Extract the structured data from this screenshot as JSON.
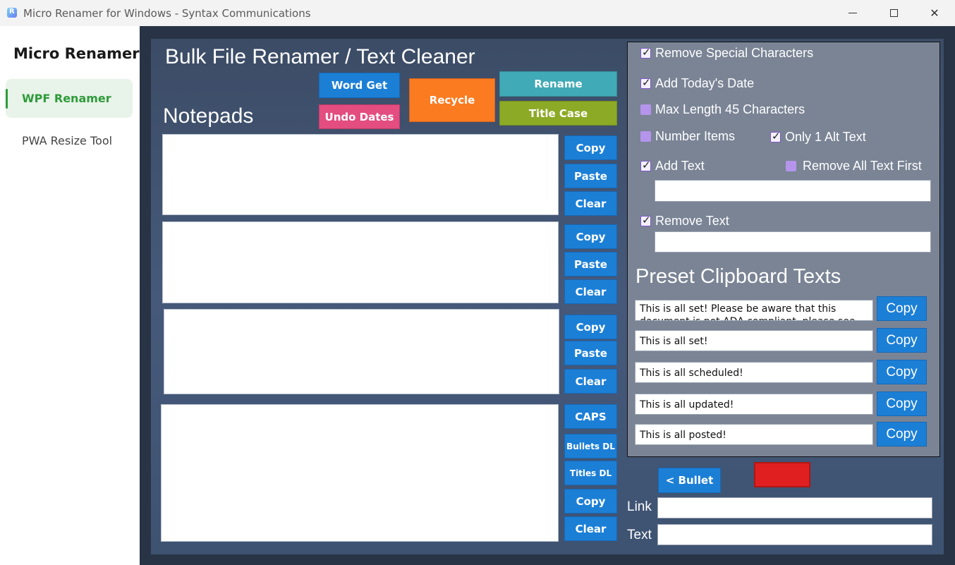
{
  "window": {
    "title": "Micro Renamer for Windows - Syntax Communications",
    "minimize_glyph": "",
    "close_glyph": "✕"
  },
  "sidebar": {
    "title": "Micro Renamer",
    "items": [
      {
        "label": "WPF Renamer",
        "active": true
      },
      {
        "label": "PWA Resize Tool",
        "active": false
      }
    ]
  },
  "main": {
    "title": "Bulk File Renamer / Text Cleaner",
    "notepads_heading": "Notepads",
    "top_buttons": {
      "word_get": "Word Get",
      "undo_dates": "Undo Dates",
      "recycle": "Recycle",
      "rename": "Rename",
      "title_case": "Title Case"
    },
    "notepad_buttons": {
      "pad1": [
        "Copy",
        "Paste",
        "Clear"
      ],
      "pad2": [
        "Copy",
        "Paste",
        "Clear"
      ],
      "pad3": [
        "Copy",
        "Paste",
        "Clear"
      ],
      "pad4": [
        "CAPS",
        "Bullets DL",
        "Titles DL",
        "Copy",
        "Clear"
      ]
    }
  },
  "options": {
    "remove_special": {
      "label": "Remove Special Characters",
      "checked": true
    },
    "add_date": {
      "label": "Add Today's Date",
      "checked": true
    },
    "max_length": {
      "label": "Max Length 45 Characters",
      "checked": false
    },
    "number_items": {
      "label": "Number Items",
      "checked": false
    },
    "only_alt": {
      "label": "Only 1 Alt Text",
      "checked": true
    },
    "add_text": {
      "label": "Add Text",
      "checked": true
    },
    "remove_all_first": {
      "label": "Remove All Text First",
      "checked": false
    },
    "remove_text": {
      "label": "Remove Text",
      "checked": true
    }
  },
  "presets": {
    "heading": "Preset Clipboard Texts",
    "copy_label": "Copy",
    "items": [
      "This is all set! Please be aware that this document is not ADA compliant, please see more",
      "This is all set!",
      "This is all scheduled!",
      "This is all updated!",
      "This is all posted!"
    ]
  },
  "link_section": {
    "bullet_button": "< Bullet",
    "link_label": "Link",
    "text_label": "Text",
    "link_value": "",
    "text_value": ""
  },
  "colors": {
    "accent_blue": "#1c7fd6",
    "pink": "#e34d80",
    "orange": "#fb7b21",
    "teal": "#40aab6",
    "green": "#8caa25",
    "red": "#e02020",
    "sidebar_active": "#2e9b3a"
  }
}
